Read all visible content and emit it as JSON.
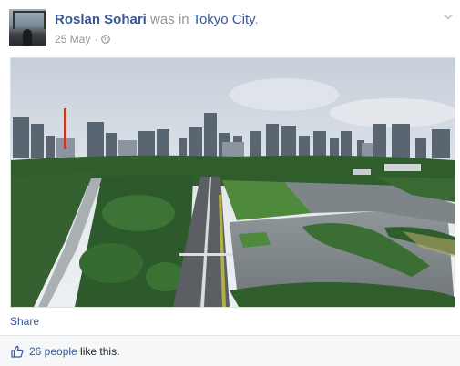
{
  "post": {
    "author": "Roslan Sohari",
    "connector": " was in ",
    "place": "Tokyo City",
    "place_suffix": ".",
    "date": "25 May",
    "separator": "·",
    "privacy_icon": "globe-icon",
    "options_icon": "chevron-down-icon"
  },
  "photo": {
    "subject": "Tokyo skyline with Imperial Palace gardens"
  },
  "actions": {
    "share_label": "Share"
  },
  "likes": {
    "icon": "thumbs-up-icon",
    "count_label": "26 people",
    "suffix": " like this."
  },
  "colors": {
    "link": "#365899",
    "meta": "#90949c",
    "footer_bg": "#f6f7f9"
  }
}
